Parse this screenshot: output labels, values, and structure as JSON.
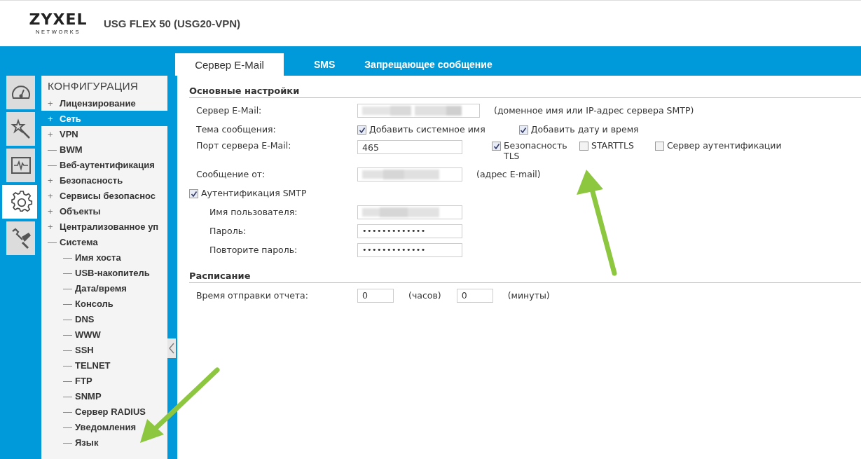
{
  "header": {
    "brand": "ZYXEL",
    "brand_sub": "NETWORKS",
    "model": "USG FLEX 50 (USG20-VPN)"
  },
  "tabs": [
    {
      "label": "Сервер E-Mail",
      "selected": true
    },
    {
      "label": "SMS",
      "selected": false
    },
    {
      "label": "Запрещающее сообщение",
      "selected": false
    }
  ],
  "nav_icons": [
    {
      "kind": "dashboard",
      "selected": false
    },
    {
      "kind": "wizard",
      "selected": false
    },
    {
      "kind": "monitor",
      "selected": false
    },
    {
      "kind": "configuration",
      "selected": true
    },
    {
      "kind": "maintenance",
      "selected": false
    }
  ],
  "sidebar": {
    "title": "КОНФИГУРАЦИЯ",
    "items": [
      {
        "sign": "+",
        "label": "Лицензирование",
        "selected": false
      },
      {
        "sign": "+",
        "label": "Сеть",
        "selected": true
      },
      {
        "sign": "+",
        "label": "VPN",
        "selected": false
      },
      {
        "sign": "—",
        "label": "BWM",
        "selected": false
      },
      {
        "sign": "—",
        "label": "Веб-аутентификация",
        "selected": false
      },
      {
        "sign": "+",
        "label": "Безопасность",
        "selected": false
      },
      {
        "sign": "+",
        "label": "Сервисы безопаснос",
        "selected": false
      },
      {
        "sign": "+",
        "label": "Объекты",
        "selected": false
      },
      {
        "sign": "+",
        "label": "Централизованное уп",
        "selected": false
      },
      {
        "sign": "—",
        "label": "Система",
        "selected": false,
        "children": [
          {
            "sign": "—",
            "label": "Имя хоста",
            "selected": false
          },
          {
            "sign": "—",
            "label": "USB-накопитель",
            "selected": false
          },
          {
            "sign": "—",
            "label": "Дата/время",
            "selected": false
          },
          {
            "sign": "—",
            "label": "Консоль",
            "selected": false
          },
          {
            "sign": "—",
            "label": "DNS",
            "selected": false
          },
          {
            "sign": "—",
            "label": "WWW",
            "selected": false
          },
          {
            "sign": "—",
            "label": "SSH",
            "selected": false
          },
          {
            "sign": "—",
            "label": "TELNET",
            "selected": false
          },
          {
            "sign": "—",
            "label": "FTP",
            "selected": false
          },
          {
            "sign": "—",
            "label": "SNMP",
            "selected": false
          },
          {
            "sign": "—",
            "label": "Сервер RADIUS",
            "selected": false
          },
          {
            "sign": "—",
            "label": "Уведомления",
            "selected": false
          },
          {
            "sign": "—",
            "label": "Язык",
            "selected": false
          }
        ]
      }
    ]
  },
  "basic_settings": {
    "title": "Основные настройки",
    "server": {
      "label": "Сервер E-Mail:",
      "redacted": true,
      "hint": "(доменное имя или IP-адрес сервера SMTP)"
    },
    "subject": {
      "label": "Тема сообщения:",
      "options": [
        {
          "label": "Добавить системное имя",
          "checked": true
        },
        {
          "label": "Добавить дату и время",
          "checked": true
        }
      ]
    },
    "port": {
      "label": "Порт сервера E-Mail:",
      "value": "465",
      "options": [
        {
          "label": "Безопасность TLS",
          "checked": true
        },
        {
          "label": "STARTTLS",
          "checked": false
        },
        {
          "label": "Сервер аутентификации",
          "checked": false
        }
      ]
    },
    "from": {
      "label": "Сообщение от:",
      "redacted": true,
      "hint": "(адрес E-mail)"
    },
    "smtp_auth": {
      "label": "Аутентификация SMTP",
      "checked": true
    },
    "username": {
      "label": "Имя пользователя:",
      "redacted": true
    },
    "password": {
      "label": "Пароль:",
      "value": "•••••••••••••"
    },
    "repeat_password": {
      "label": "Повторите пароль:",
      "value": "•••••••••••••"
    }
  },
  "schedule": {
    "title": "Расписание",
    "label": "Время отправки отчета:",
    "hours": {
      "value": "0",
      "unit": "(часов)"
    },
    "minutes": {
      "value": "0",
      "unit": "(минуты)"
    }
  },
  "annotations": [
    {
      "kind": "arrow"
    },
    {
      "kind": "arrow"
    }
  ]
}
